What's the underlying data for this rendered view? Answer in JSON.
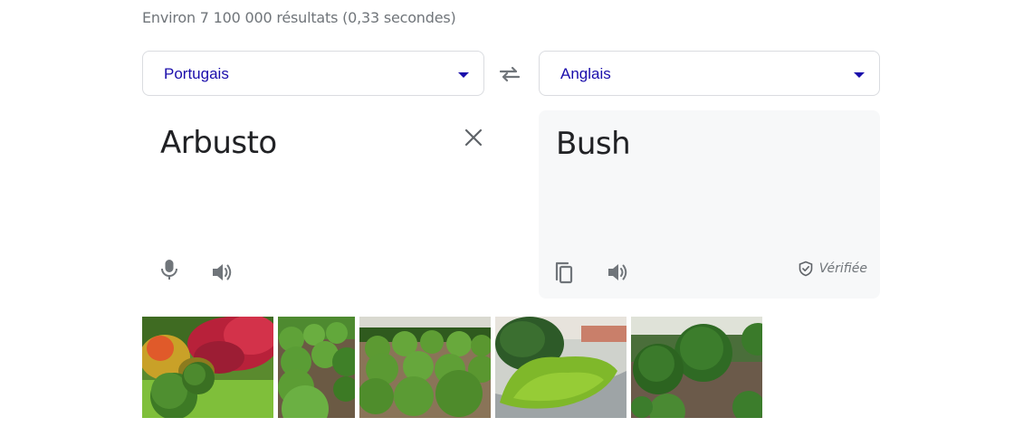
{
  "results": {
    "stats": "Environ 7 100 000 résultats (0,33 secondes)"
  },
  "translator": {
    "source_language": "Portugais",
    "target_language": "Anglais",
    "source_text": "Arbusto",
    "target_text": "Bush",
    "verified_label": "Vérifiée"
  },
  "icons": {
    "swap": "swap-icon",
    "clear": "close-icon",
    "microphone": "microphone-icon",
    "speaker": "speaker-icon",
    "copy": "copy-icon",
    "verified": "shield-check-icon"
  },
  "colors": {
    "link_blue": "#1a0dab",
    "icon_gray": "#70757a",
    "text": "#202124",
    "panel_bg": "#f7f8f9",
    "border": "#dadce0"
  }
}
